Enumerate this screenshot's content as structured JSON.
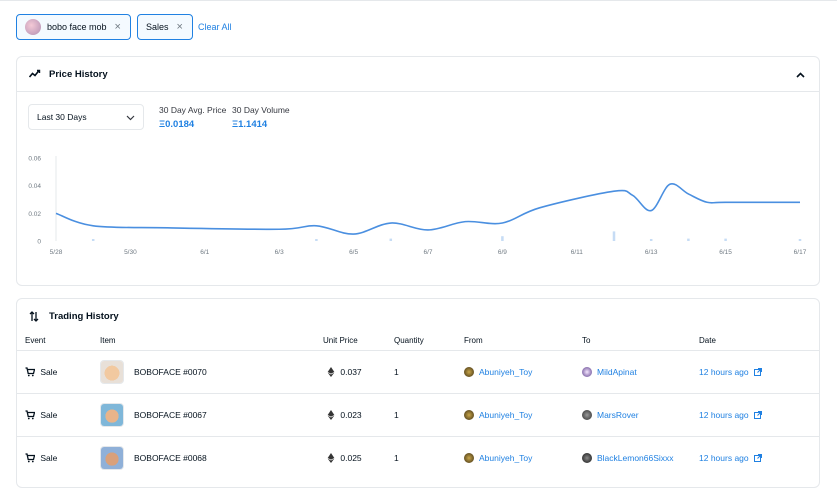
{
  "filters": {
    "chips": [
      {
        "label": "bobo face mob",
        "remove": "×"
      },
      {
        "label": "Sales",
        "remove": "×"
      }
    ],
    "clear_all": "Clear All"
  },
  "price_history": {
    "title": "Price History",
    "range_select": "Last 30 Days",
    "avg_label": "30 Day Avg. Price",
    "avg_value": "Ξ0.0184",
    "volume_label": "30 Day Volume",
    "volume_value": "Ξ1.1414",
    "chart_data": {
      "type": "line",
      "title": "",
      "xlabel": "",
      "ylabel": "",
      "x_ticks": [
        "5/28",
        "5/30",
        "6/1",
        "6/3",
        "6/5",
        "6/7",
        "6/9",
        "6/11",
        "6/13",
        "6/15",
        "6/17"
      ],
      "y_ticks": [
        "0",
        "0.02",
        "0.04",
        "0.06"
      ],
      "ylim": [
        0,
        0.06
      ],
      "xlim": [
        0,
        20
      ],
      "grid": false,
      "series": [
        {
          "x": [
            0,
            1,
            3,
            6,
            7,
            8,
            9,
            10,
            11,
            12,
            13,
            15,
            15.5,
            16,
            16.5,
            17,
            17.5,
            18,
            20
          ],
          "values": [
            0.02,
            0.011,
            0.0095,
            0.0085,
            0.011,
            0.005,
            0.013,
            0.008,
            0.014,
            0.013,
            0.024,
            0.036,
            0.033,
            0.022,
            0.041,
            0.034,
            0.028,
            0.028,
            0.028
          ]
        }
      ],
      "volume_bars": {
        "x": [
          1,
          7,
          9,
          12,
          15,
          16,
          17,
          18,
          20
        ],
        "values": [
          0.02,
          0.02,
          0.03,
          0.06,
          0.12,
          0.02,
          0.03,
          0.03,
          0.02
        ]
      }
    }
  },
  "trading_history": {
    "title": "Trading History",
    "columns": [
      "Event",
      "Item",
      "Unit Price",
      "Quantity",
      "From",
      "To",
      "Date"
    ],
    "rows": [
      {
        "event": "Sale",
        "item": "BOBOFACE #0070",
        "price": "0.037",
        "quantity": "1",
        "from": "Abuniyeh_Toy",
        "to": "MildApinat",
        "date": "12 hours ago"
      },
      {
        "event": "Sale",
        "item": "BOBOFACE #0067",
        "price": "0.023",
        "quantity": "1",
        "from": "Abuniyeh_Toy",
        "to": "MarsRover",
        "date": "12 hours ago"
      },
      {
        "event": "Sale",
        "item": "BOBOFACE #0068",
        "price": "0.025",
        "quantity": "1",
        "from": "Abuniyeh_Toy",
        "to": "BlackLemon66Sixxx",
        "date": "12 hours ago"
      }
    ]
  },
  "colors": {
    "accent": "#2081e2",
    "line": "#4a8fe0",
    "bar": "#c6dcf5"
  },
  "icons": {
    "cart": "cart-icon",
    "external": "external-link-icon",
    "eth": "eth-icon"
  }
}
